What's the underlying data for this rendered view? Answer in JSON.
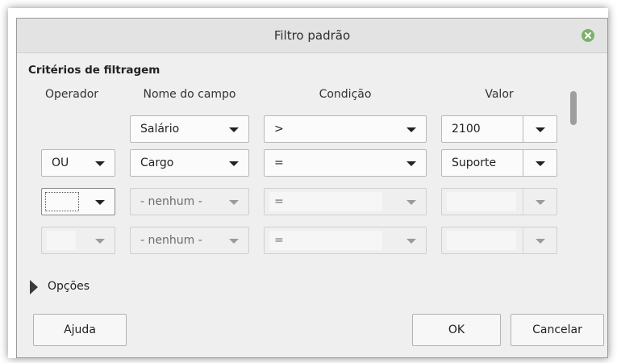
{
  "dialog": {
    "title": "Filtro padrão",
    "close_icon": "close-circle-icon",
    "close_color": "#7ab26b"
  },
  "criteria": {
    "section_title": "Critérios de filtragem",
    "headers": {
      "operator": "Operador",
      "field_name": "Nome do campo",
      "condition": "Condição",
      "value": "Valor"
    },
    "rows": [
      {
        "operator": "",
        "field": "Salário",
        "condition": ">",
        "value": "2100"
      },
      {
        "operator": "OU",
        "field": "Cargo",
        "condition": "=",
        "value": "Suporte"
      },
      {
        "operator": "",
        "field": "- nenhum -",
        "condition": "=",
        "value": ""
      },
      {
        "operator": "",
        "field": "- nenhum -",
        "condition": "=",
        "value": ""
      }
    ]
  },
  "options": {
    "label": "Opções",
    "icon": "expand-triangle-icon"
  },
  "buttons": {
    "help": "Ajuda",
    "ok": "OK",
    "cancel": "Cancelar"
  }
}
